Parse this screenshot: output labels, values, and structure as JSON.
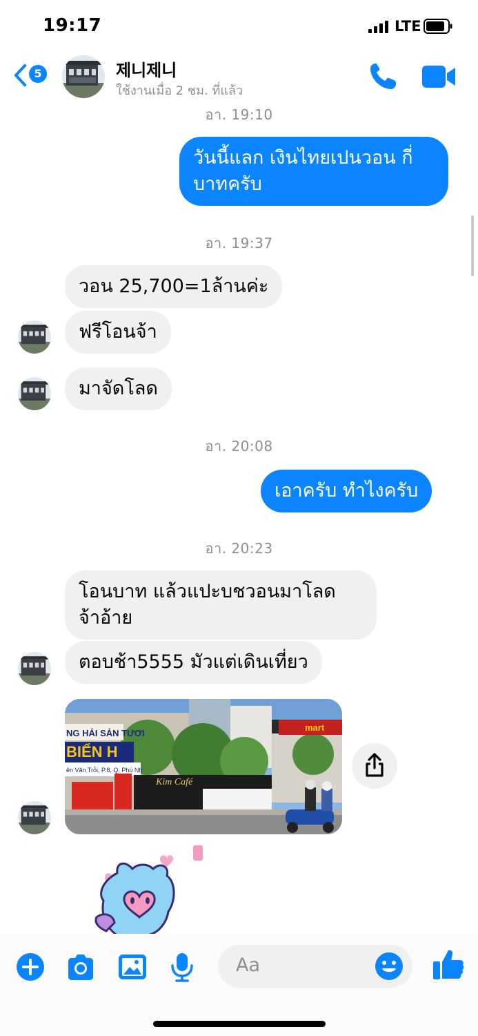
{
  "status_bar": {
    "time": "19:17",
    "network": "LTE"
  },
  "header": {
    "back_badge": "5",
    "contact_name": "제니제니",
    "contact_status": "ใช้งานเมื่อ 2 ชม. ที่แล้ว"
  },
  "messages": [
    {
      "type": "timestamp",
      "text": "อา. 19:10"
    },
    {
      "type": "outgoing",
      "lines": [
        "วันนี้แลก เงินไทยเปนวอน กี่",
        "บาทครับ"
      ]
    },
    {
      "type": "timestamp",
      "text": "อา. 19:37"
    },
    {
      "type": "incoming",
      "text": "วอน 25,700=1ล้านค่ะ"
    },
    {
      "type": "incoming",
      "text": "ฟรีโอนจ้า"
    },
    {
      "type": "incoming",
      "text": "มาจัดโลด"
    },
    {
      "type": "timestamp",
      "text": "อา. 20:08"
    },
    {
      "type": "outgoing",
      "text": "เอาครับ ทำไงครับ"
    },
    {
      "type": "timestamp",
      "text": "อา. 20:23"
    },
    {
      "type": "incoming",
      "lines": [
        "โอนบาท แล้วแปะบชวอนมาโลด",
        "จ้าอ้าย"
      ]
    },
    {
      "type": "incoming",
      "text": "ตอบช้า5555 มัวแต่เดินเที่ยว"
    },
    {
      "type": "photo",
      "signs": {
        "s1": "NG HẢI SẢN TƯƠI",
        "s2": "BIỂN H",
        "s3": "ên Văn Trỗi, P.8, Q. Phú Nh",
        "s4": "Kim Café",
        "s5": "mart"
      }
    }
  ],
  "composer": {
    "placeholder": "Aa"
  },
  "colors": {
    "accent": "#0a84ff",
    "incoming_bubble": "#f0f0f0",
    "timestamp": "#8a8d91"
  },
  "icons": [
    "back-chevron-icon",
    "phone-icon",
    "video-camera-icon",
    "plus-icon",
    "camera-icon",
    "gallery-icon",
    "microphone-icon",
    "emoji-icon",
    "thumbs-up-icon",
    "share-icon"
  ]
}
